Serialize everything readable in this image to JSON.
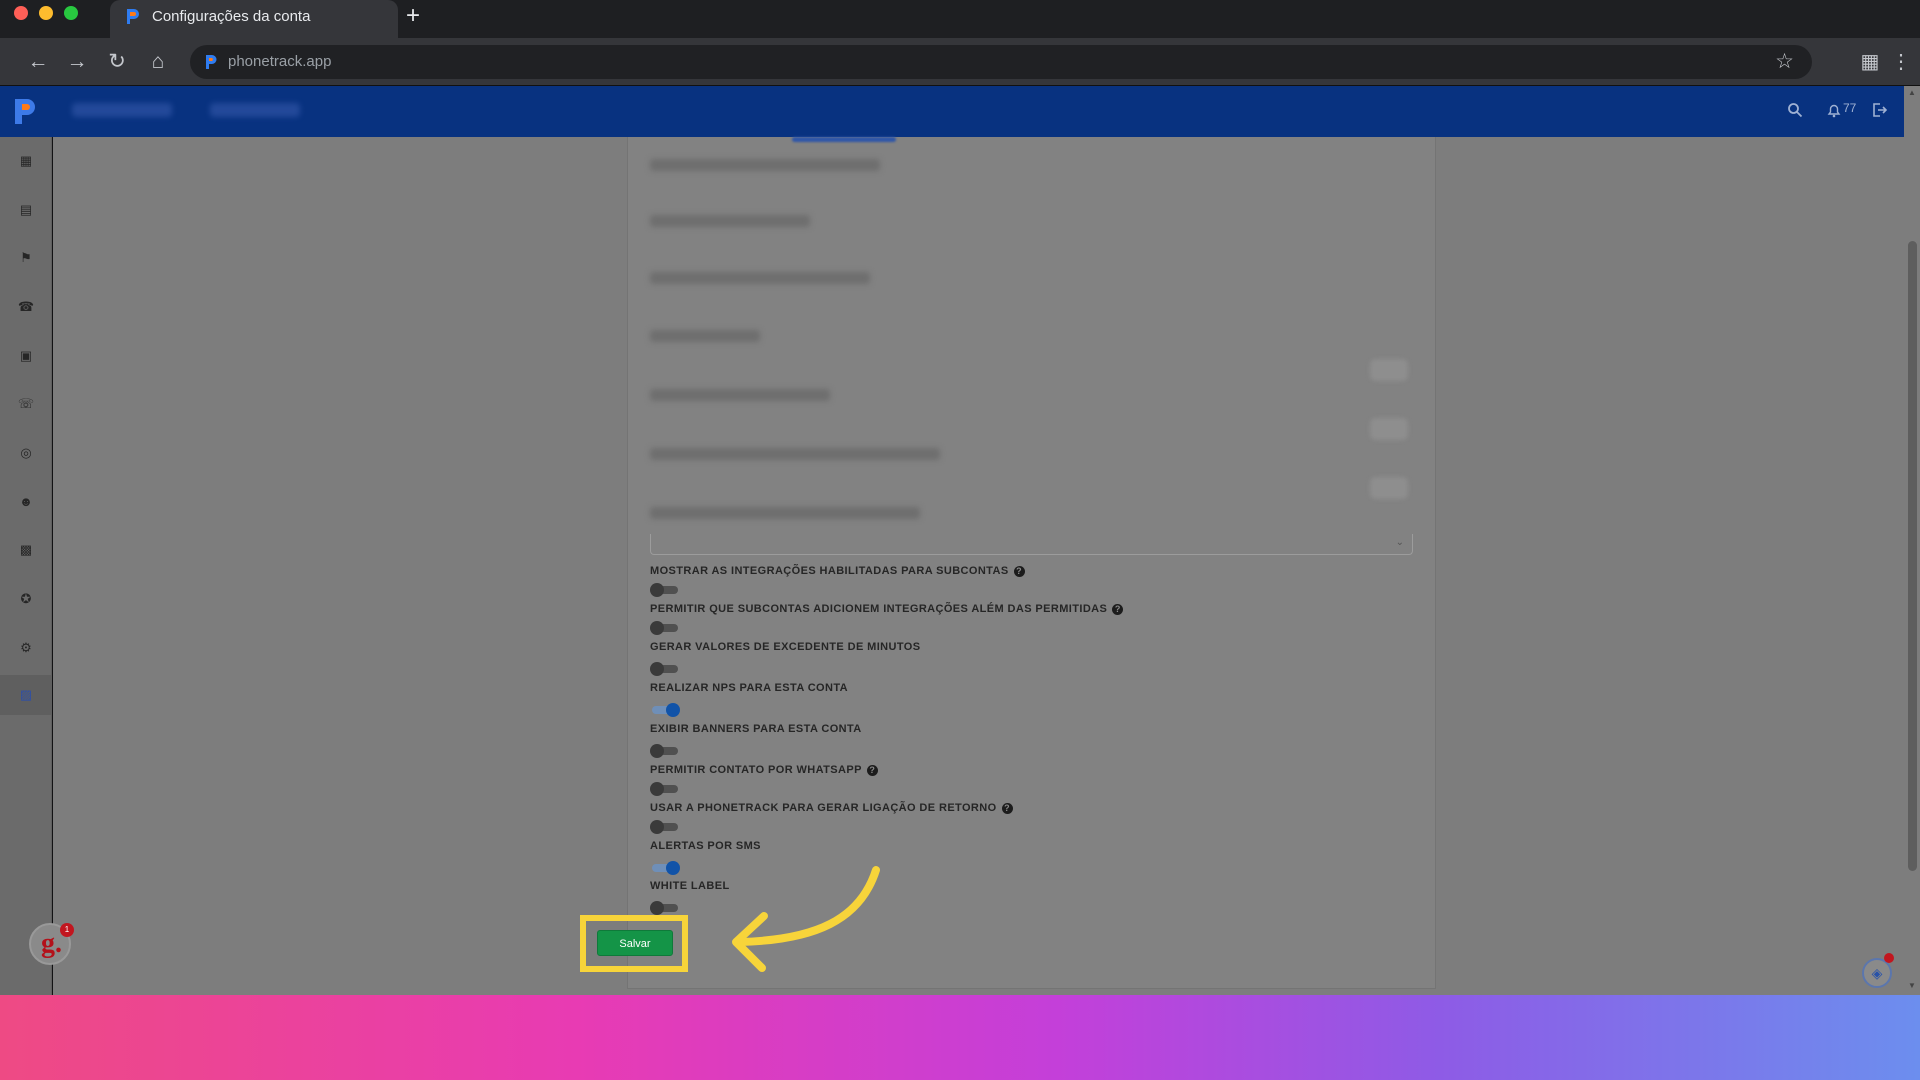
{
  "browser": {
    "tab_title": "Configurações da conta",
    "new_tab_symbol": "+",
    "url": "phonetrack.app"
  },
  "header": {
    "notification_count": "77"
  },
  "settings": [
    {
      "label": "MOSTRAR AS INTEGRAÇÕES HABILITADAS PARA SUBCONTAS",
      "has_help": true,
      "enabled": false
    },
    {
      "label": "PERMITIR QUE SUBCONTAS ADICIONEM INTEGRAÇÕES ALÉM DAS PERMITIDAS",
      "has_help": true,
      "enabled": false
    },
    {
      "label": "GERAR VALORES DE EXCEDENTE DE MINUTOS",
      "has_help": false,
      "enabled": false
    },
    {
      "label": "REALIZAR NPS PARA ESTA CONTA",
      "has_help": false,
      "enabled": true
    },
    {
      "label": "EXIBIR BANNERS PARA ESTA CONTA",
      "has_help": false,
      "enabled": false
    },
    {
      "label": "PERMITIR CONTATO POR WHATSAPP",
      "has_help": true,
      "enabled": false
    },
    {
      "label": "USAR A PHONETRACK PARA GERAR LIGAÇÃO DE RETORNO",
      "has_help": true,
      "enabled": false
    },
    {
      "label": "ALERTAS POR SMS",
      "has_help": false,
      "enabled": true
    },
    {
      "label": "WHITE LABEL",
      "has_help": false,
      "enabled": false
    }
  ],
  "help_symbol": "?",
  "save_button": "Salvar",
  "widgets": {
    "gbadge_letter": "g.",
    "gbadge_count": "1"
  },
  "colors": {
    "header_bg": "#083280",
    "save_green": "#149447",
    "highlight_yellow": "#f7d43a",
    "toggle_on": "#1153a8"
  }
}
